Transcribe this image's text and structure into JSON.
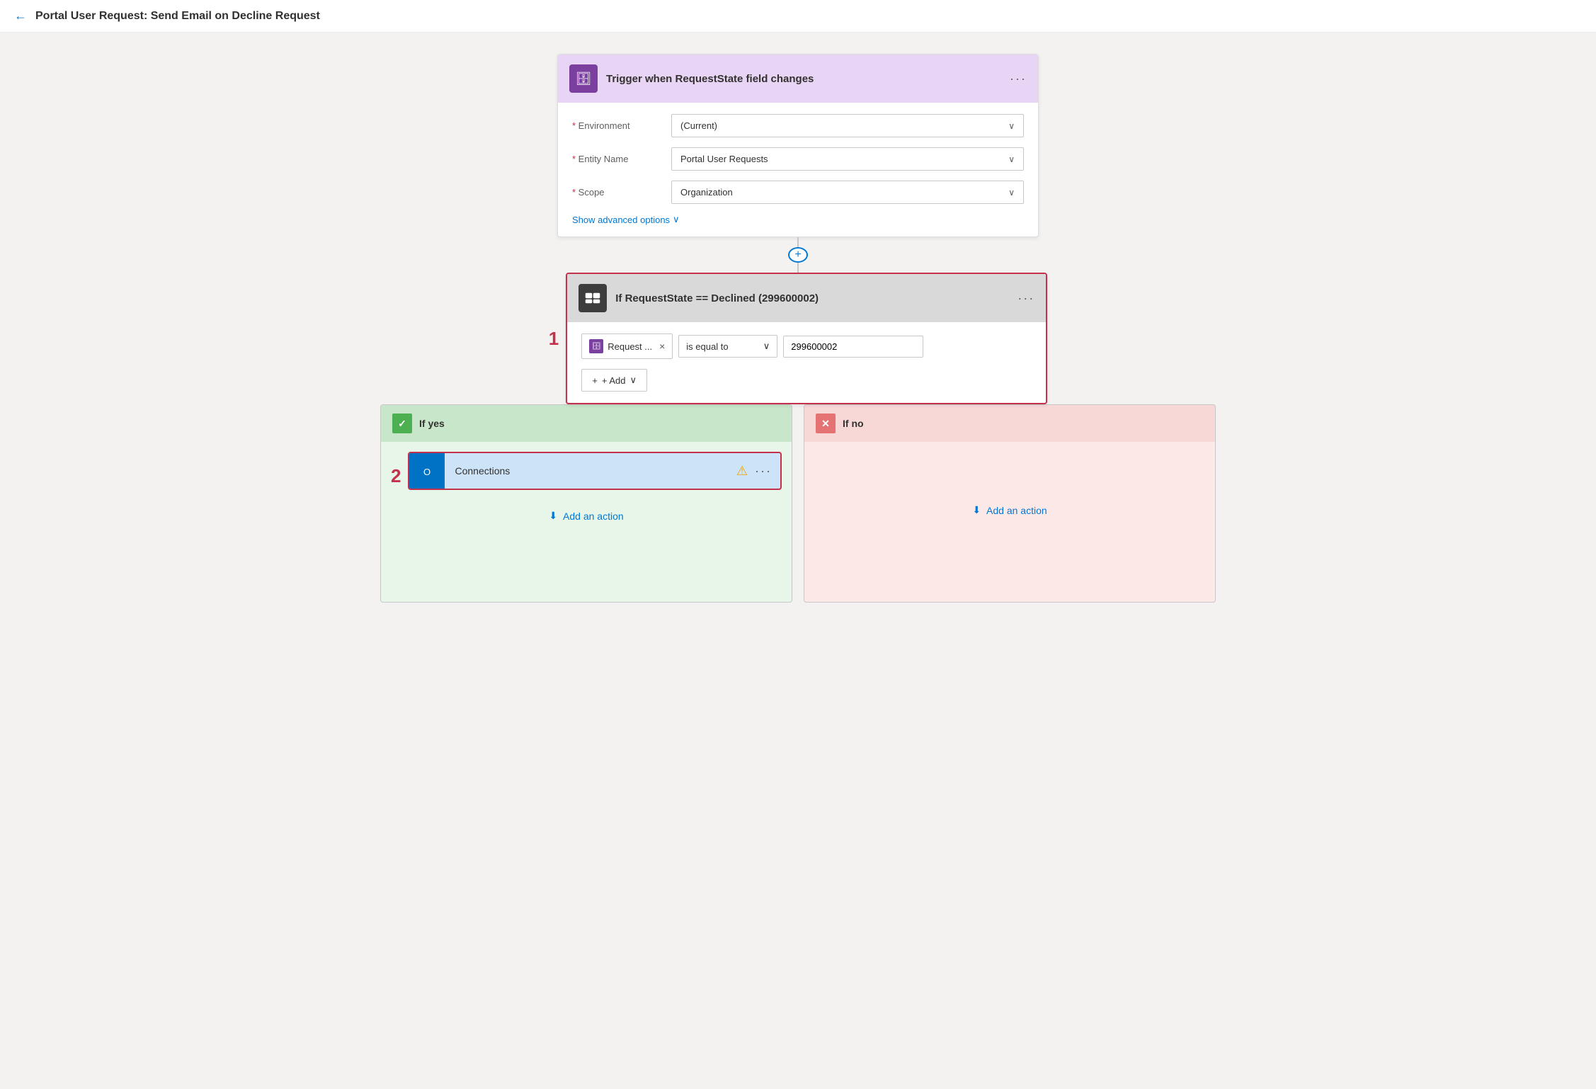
{
  "header": {
    "back_label": "←",
    "title": "Portal User Request: Send Email on Decline Request"
  },
  "trigger": {
    "icon": "🗄",
    "title": "Trigger when RequestState field changes",
    "three_dots": "···",
    "fields": [
      {
        "label": "* Environment",
        "value": "(Current)"
      },
      {
        "label": "* Entity Name",
        "value": "Portal User Requests"
      },
      {
        "label": "* Scope",
        "value": "Organization"
      }
    ],
    "show_advanced": "Show advanced options",
    "show_advanced_chevron": "∨"
  },
  "connector": {
    "plus": "+"
  },
  "condition": {
    "number": "1",
    "icon": "⊞",
    "title": "If RequestState == Declined (299600002)",
    "three_dots": "···",
    "token_label": "Request ...",
    "token_close": "×",
    "operator": "is equal to",
    "value": "299600002",
    "add_label": "+ Add",
    "add_chevron": "∨"
  },
  "branches": {
    "yes": {
      "number": "2",
      "check": "✓",
      "label": "If yes",
      "connection": {
        "icon": "O",
        "label": "Connections",
        "three_dots": "···"
      },
      "add_action": "Add an action"
    },
    "no": {
      "x": "✕",
      "label": "If no",
      "add_action": "Add an action"
    }
  }
}
